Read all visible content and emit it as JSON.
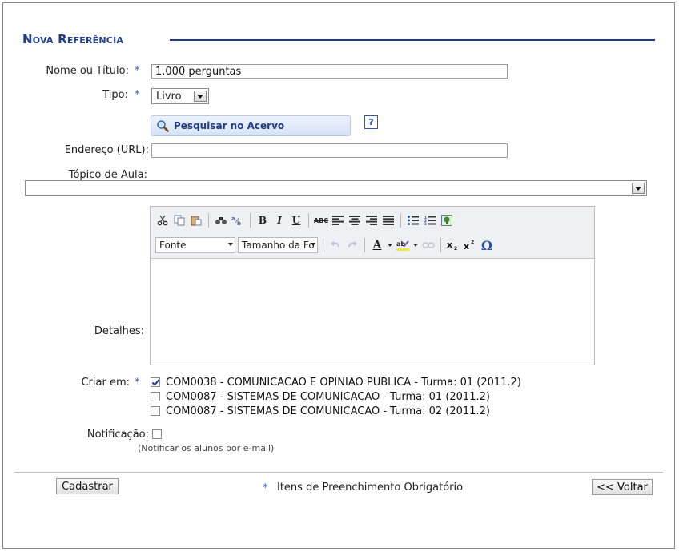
{
  "form": {
    "title": "Nova Referência",
    "fields": {
      "nome_label": "Nome ou Título:",
      "nome_value": "1.000 perguntas",
      "tipo_label": "Tipo:",
      "tipo_value": "Livro",
      "search_button": "Pesquisar no Acervo",
      "help_label": "?",
      "url_label": "Endereço (URL):",
      "url_value": "",
      "topico_label": "Tópico de Aula:",
      "topico_value": "",
      "detalhes_label": "Detalhes:",
      "criar_label": "Criar em:",
      "notificacao_label": "Notificação:",
      "notificacao_note": "(Notificar os alunos por e-mail)"
    },
    "required_star": "*",
    "editor_toolbar": {
      "font_select": "Fonte",
      "size_select": "Tamanho da Fo"
    },
    "courses": [
      {
        "label": "COM0038 - COMUNICACAO E OPINIAO PUBLICA - Turma: 01 (2011.2)",
        "checked": true
      },
      {
        "label": "COM0087 - SISTEMAS DE COMUNICACAO - Turma: 01 (2011.2)",
        "checked": false
      },
      {
        "label": "COM0087 - SISTEMAS DE COMUNICACAO - Turma: 02 (2011.2)",
        "checked": false
      }
    ],
    "notificacao_checked": false
  },
  "footer": {
    "submit_button": "Cadastrar",
    "required_legend": "Itens de Preenchimento Obrigatório",
    "back_button": "<< Voltar"
  },
  "colors": {
    "title": "#1f3d8c",
    "required_star": "#2a5bd7"
  },
  "icons": [
    "search-icon",
    "help-icon",
    "cut-icon",
    "copy-icon",
    "paste-icon",
    "find-icon",
    "replace-icon",
    "bold-icon",
    "italic-icon",
    "underline-icon",
    "strikethrough-icon",
    "align-left-icon",
    "align-center-icon",
    "align-right-icon",
    "align-justify-icon",
    "bullet-list-icon",
    "numbered-list-icon",
    "image-icon",
    "undo-icon",
    "redo-icon",
    "text-color-icon",
    "highlight-color-icon",
    "link-icon",
    "subscript-icon",
    "superscript-icon",
    "special-char-icon"
  ]
}
